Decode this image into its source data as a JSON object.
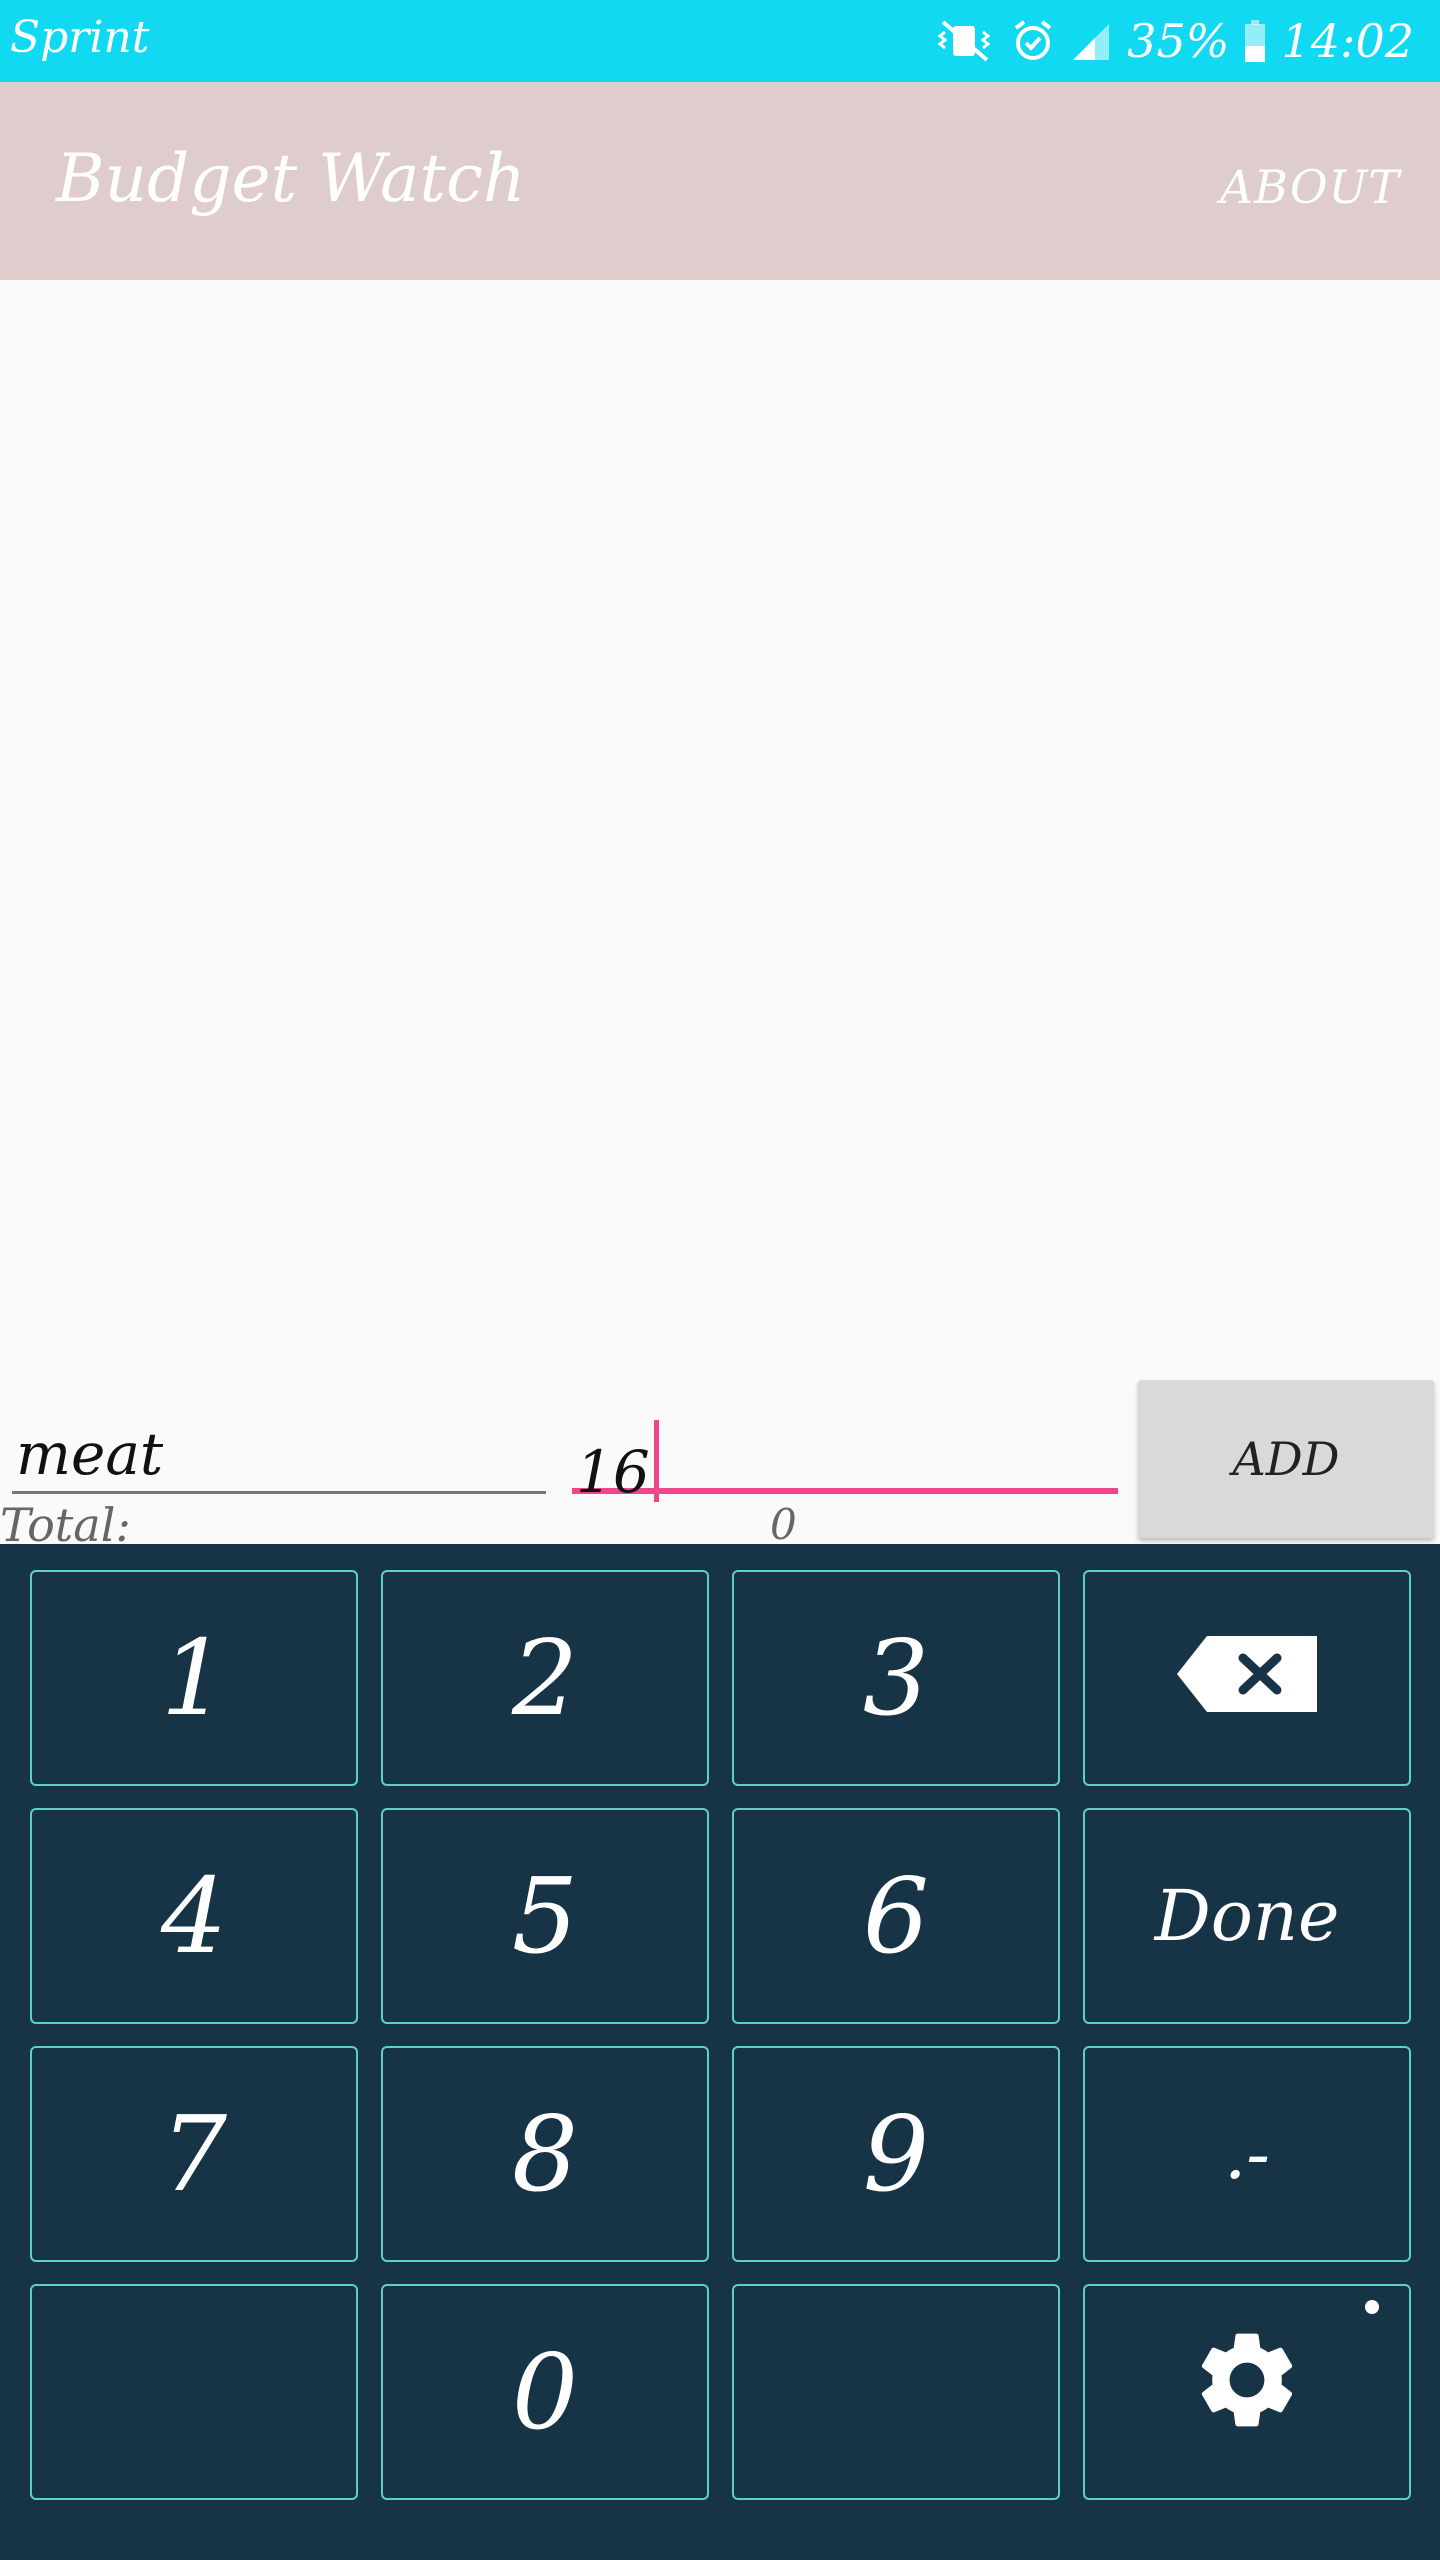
{
  "status_bar": {
    "carrier": "Sprint",
    "battery_percent": "35%",
    "time": "14:02",
    "icons": [
      "vibrate-mute-icon",
      "alarm-icon",
      "signal-icon",
      "battery-icon"
    ]
  },
  "app_bar": {
    "title": "Budget Watch",
    "about_label": "ABOUT"
  },
  "summary": {
    "total_label": "Total:",
    "total_value": "0"
  },
  "entry": {
    "name_value": "meat",
    "amount_value": "16",
    "add_label": "ADD"
  },
  "keypad": {
    "keys": [
      "1",
      "2",
      "3",
      "",
      "4",
      "5",
      "6",
      "Done",
      "7",
      "8",
      "9",
      ".-",
      "",
      "0",
      "",
      ""
    ],
    "icons": {
      "backspace": "backspace-icon",
      "settings": "gear-icon"
    }
  },
  "colors": {
    "status_bar": "#11d9f1",
    "app_bar": "#dfcccd",
    "accent": "#f0468a",
    "keyboard_bg": "#173447",
    "key_border": "#5ecfcf"
  }
}
